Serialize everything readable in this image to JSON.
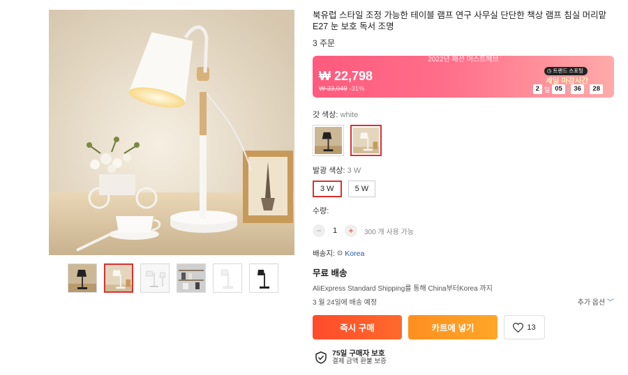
{
  "product": {
    "title": "북유럽 스타일 조정 가능한 테이블 램프 연구 사무실 단단한 책상 램프 침실 머리맡 E27 눈 보호 독서 조명",
    "orders": "3 주문"
  },
  "price": {
    "banner": "2022년 패션 머스트헤브",
    "current": "₩ 22,798",
    "original": "₩ 33,049",
    "discount": "-31%",
    "trend_badge": "트랜드 스포팅",
    "sale_label": "세일 마감시간",
    "countdown": {
      "days": "2",
      "day_unit": "일",
      "hours": "05",
      "minutes": "36",
      "seconds": "28",
      "separator": ":"
    },
    "colors": {
      "gradient_start": "#ff5a7d",
      "gradient_end": "#ffaaa9"
    }
  },
  "options": {
    "color_label": "갓 색상:",
    "color_value": "white",
    "color_swatches": [
      {
        "name": "black",
        "selected": false
      },
      {
        "name": "white",
        "selected": true
      }
    ],
    "watt_label": "발광 색상:",
    "watt_value": "3 W",
    "watts": [
      {
        "label": "3 W",
        "selected": true
      },
      {
        "label": "5 W",
        "selected": false
      }
    ]
  },
  "quantity": {
    "label": "수량:",
    "minus": "−",
    "value": "1",
    "plus": "+",
    "available": "300 개 사용 가능"
  },
  "shipping": {
    "ship_to_label": "배송지:",
    "country": "Korea",
    "free": "무료 배송",
    "detail": "AliExpress Standard Shipping를 통해 China부터Korea 까지",
    "date": "3 월 24일에 배송 예정",
    "more_options": "추가 옵션"
  },
  "actions": {
    "buy_now": "즉시 구매",
    "add_to_cart": "카트에 넣기",
    "wishlist_count": "13"
  },
  "protection": {
    "title": "75일 구매자 보호",
    "subtitle": "결제 금액 환불 보증"
  },
  "gallery": {
    "thumbnails": [
      "lamp-black-on-desk",
      "lamp-white-on-desk",
      "lamp-white-studio",
      "lamp-shelf-room",
      "lamp-white-isolated",
      "lamp-black-isolated"
    ],
    "selected_index": 1
  },
  "accent_color": "#d8302f"
}
